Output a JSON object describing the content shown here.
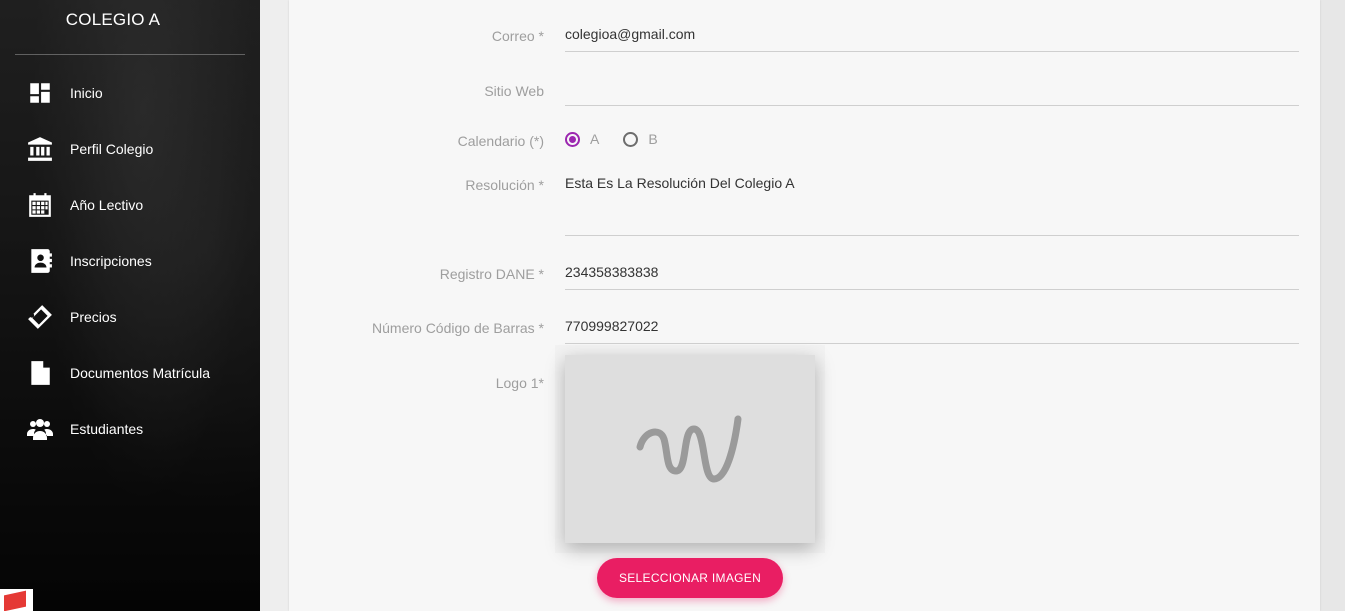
{
  "sidebar": {
    "brand": "COLEGIO A",
    "items": [
      {
        "label": "Inicio",
        "icon": "dashboard-icon"
      },
      {
        "label": "Perfil Colegio",
        "icon": "institution-icon"
      },
      {
        "label": "Año Lectivo",
        "icon": "calendar-icon"
      },
      {
        "label": "Inscripciones",
        "icon": "contact-book-icon"
      },
      {
        "label": "Precios",
        "icon": "ticket-icon"
      },
      {
        "label": "Documentos Matrícula",
        "icon": "document-icon"
      },
      {
        "label": "Estudiantes",
        "icon": "group-icon"
      }
    ]
  },
  "form": {
    "correo": {
      "label": "Correo *",
      "value": "colegioa@gmail.com"
    },
    "sitio_web": {
      "label": "Sitio Web",
      "value": ""
    },
    "calendario": {
      "label": "Calendario (*)",
      "options": [
        "A",
        "B"
      ],
      "selected": "A"
    },
    "resolucion": {
      "label": "Resolución *",
      "value": "Esta Es La Resolución Del Colegio A"
    },
    "registro_dane": {
      "label": "Registro DANE *",
      "value": "234358383838"
    },
    "codigo_barras": {
      "label": "Número Código de Barras *",
      "value": "770999827022"
    },
    "logo": {
      "label": "Logo 1*",
      "button": "SELECCIONAR IMAGEN"
    }
  },
  "colors": {
    "accent": "#e91e63",
    "radio_checked": "#9c27b0"
  }
}
